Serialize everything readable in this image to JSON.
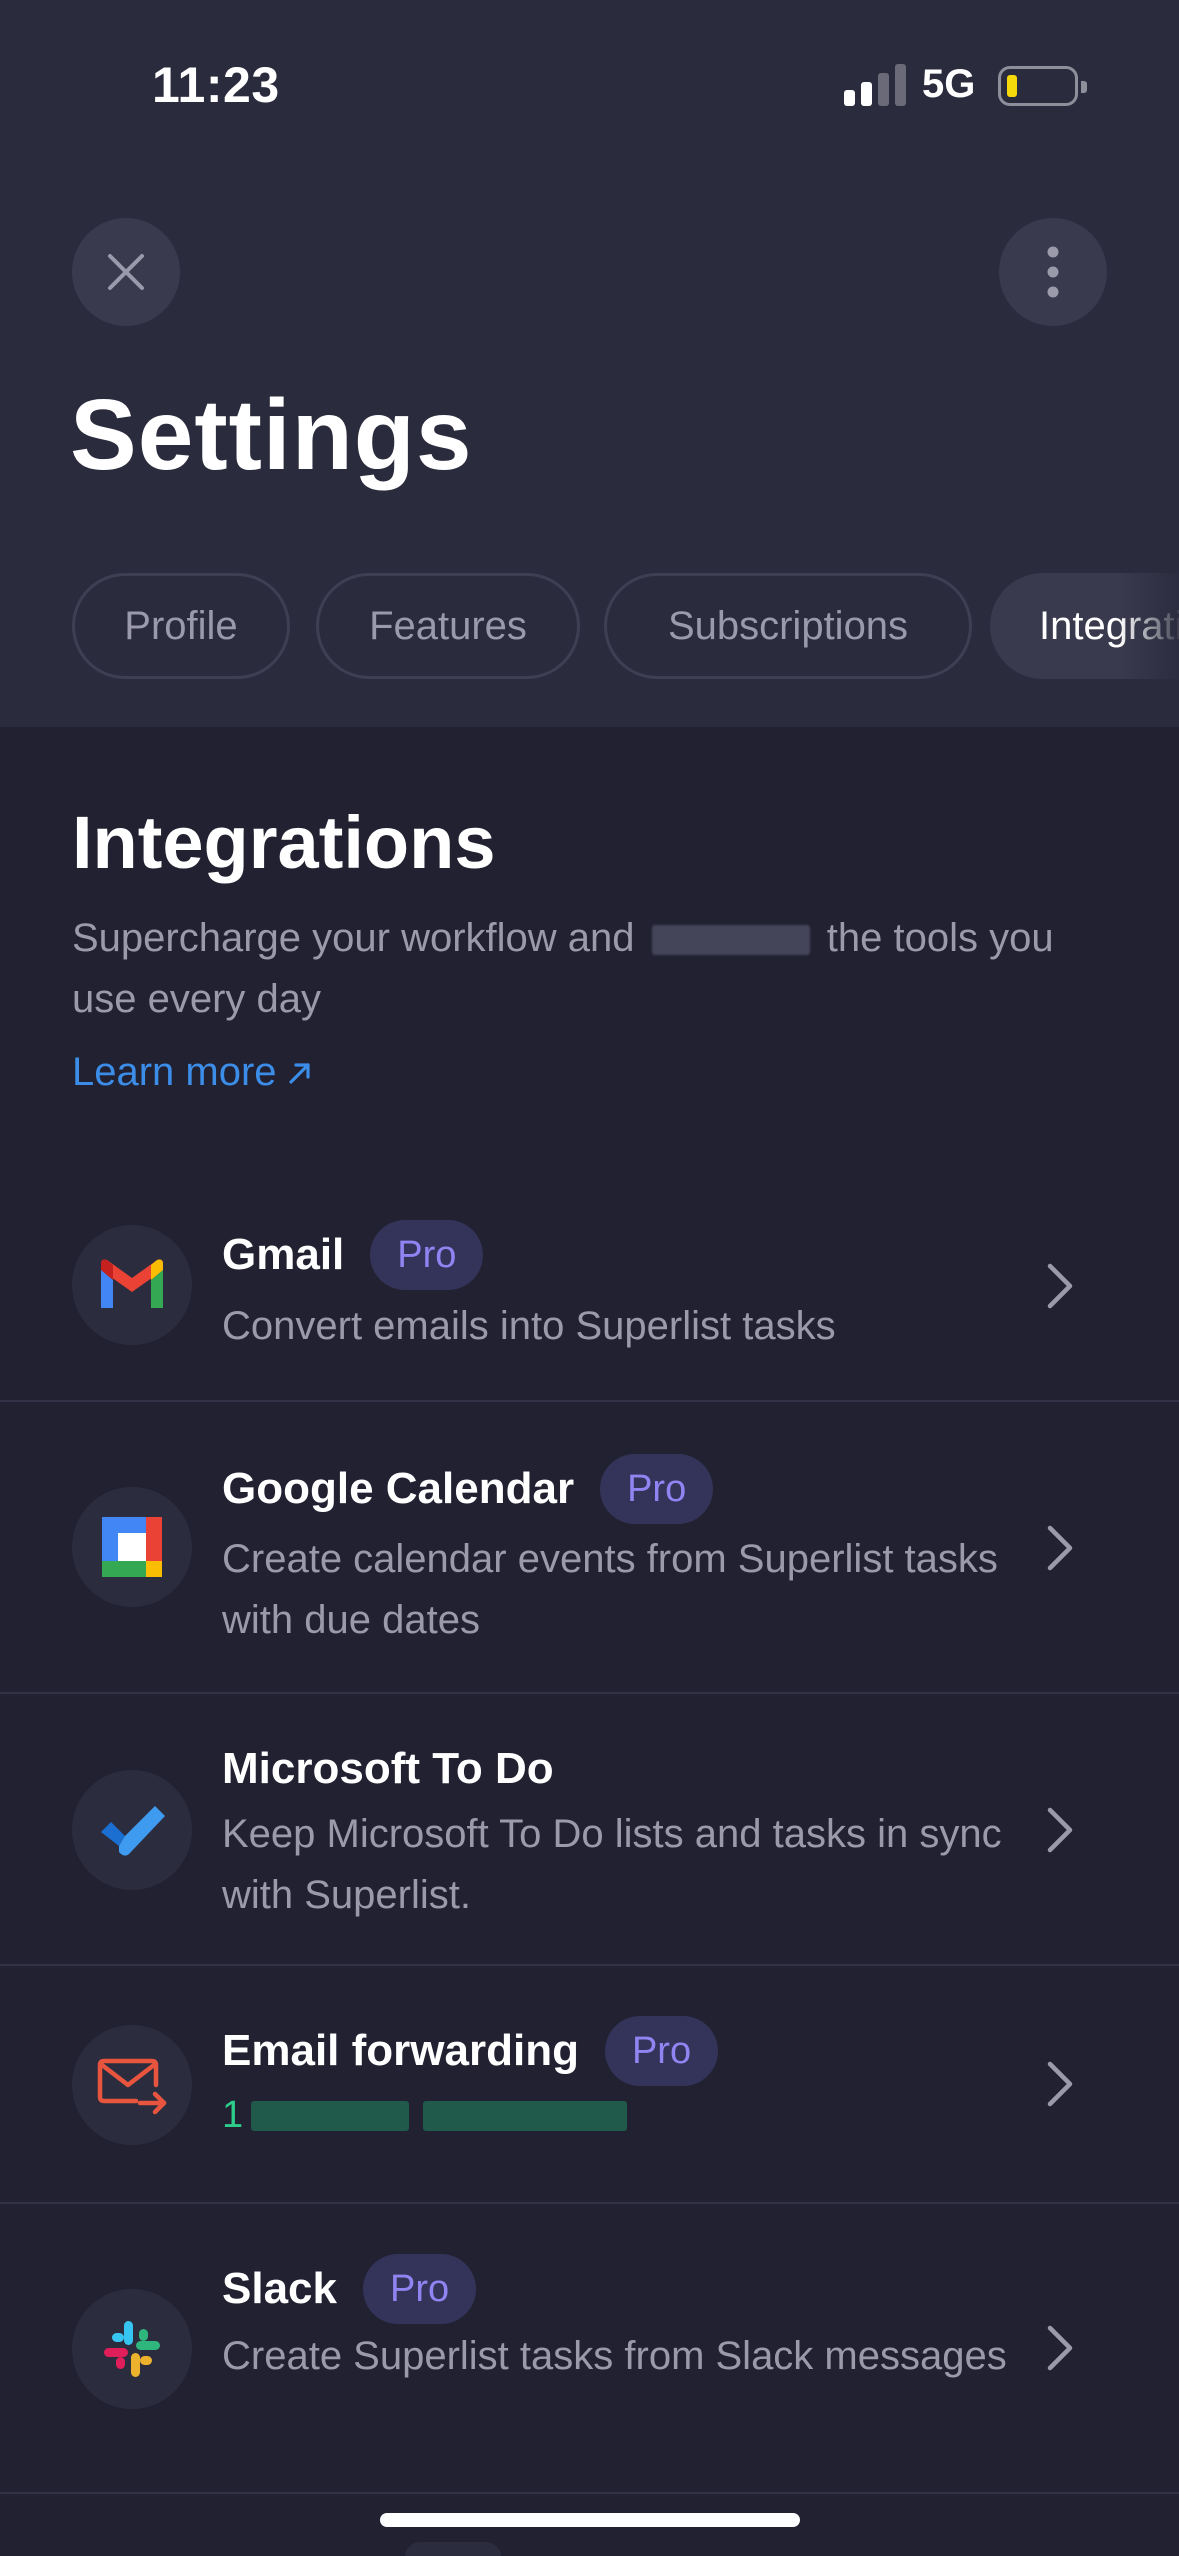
{
  "status_bar": {
    "time": "11:23",
    "network": "5G",
    "battery_color": "#f5d90a"
  },
  "header": {
    "title": "Settings",
    "tabs": [
      {
        "label": "Profile"
      },
      {
        "label": "Features"
      },
      {
        "label": "Subscriptions"
      },
      {
        "label": "Integrations",
        "active": true
      }
    ]
  },
  "section": {
    "title": "Integrations",
    "description_before": "Supercharge your workflow and",
    "description_after": "the tools you use every day",
    "learn_more": "Learn more"
  },
  "integrations": [
    {
      "name": "Gmail",
      "badge": "Pro",
      "description": "Convert emails into Superlist tasks",
      "icon": "gmail-icon"
    },
    {
      "name": "Google Calendar",
      "badge": "Pro",
      "description": "Create calendar events from Superlist tasks with due dates",
      "icon": "google-calendar-icon"
    },
    {
      "name": "Microsoft To Do",
      "description": "Keep Microsoft To Do lists and tasks in sync with Superlist.",
      "icon": "microsoft-todo-icon"
    },
    {
      "name": "Email forwarding",
      "badge": "Pro",
      "sub_visible_prefix": "1",
      "icon": "email-forward-icon"
    },
    {
      "name": "Slack",
      "badge": "Pro",
      "description": "Create Superlist tasks from Slack messages",
      "icon": "slack-icon"
    }
  ],
  "colors": {
    "accent_link": "#3c8de8",
    "badge_text": "#8f85f2",
    "badge_bg": "#34345a",
    "email_green": "#2ecc8b"
  }
}
